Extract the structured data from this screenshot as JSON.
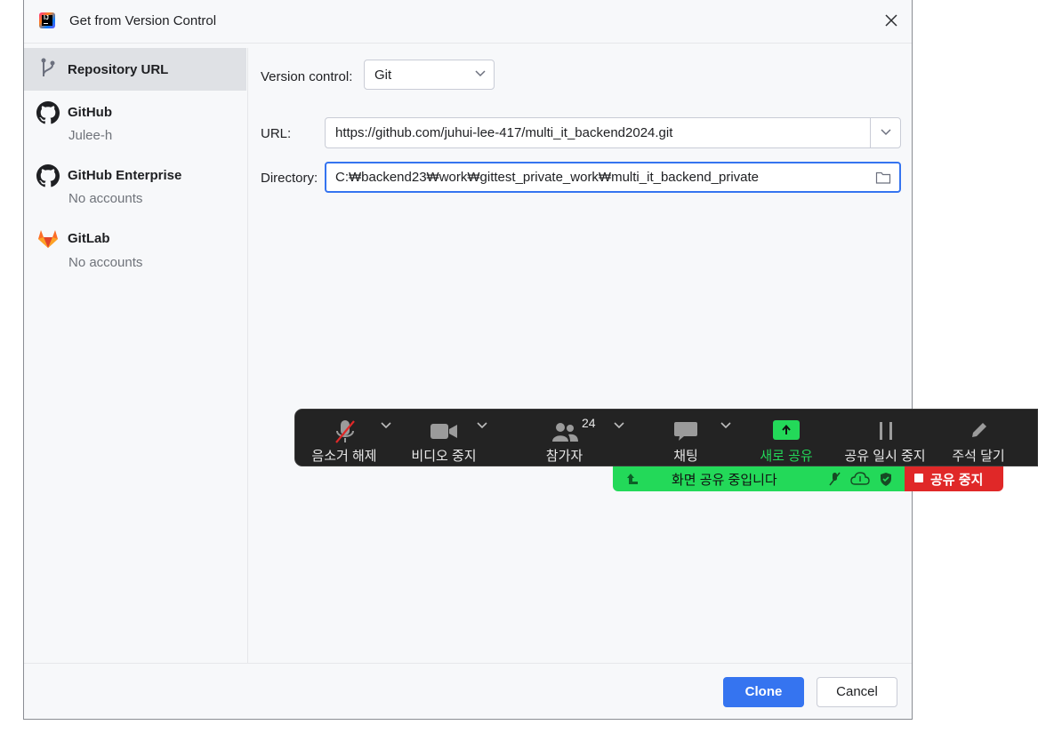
{
  "window": {
    "title": "Get from Version Control"
  },
  "sidebar": {
    "items": [
      {
        "title": "Repository URL",
        "subtitle": ""
      },
      {
        "title": "GitHub",
        "subtitle": "Julee-h"
      },
      {
        "title": "GitHub Enterprise",
        "subtitle": "No accounts"
      },
      {
        "title": "GitLab",
        "subtitle": "No accounts"
      }
    ]
  },
  "form": {
    "vcs_label": "Version control:",
    "vcs_value": "Git",
    "url_label": "URL:",
    "url_value": "https://github.com/juhui-lee-417/multi_it_backend2024.git",
    "dir_label": "Directory:",
    "dir_value": "C:₩backend23₩work₩gittest_private_work₩multi_it_backend_private"
  },
  "footer": {
    "clone_label": "Clone",
    "cancel_label": "Cancel"
  },
  "zoom": {
    "mute_label": "음소거 해제",
    "video_label": "비디오 중지",
    "participants_label": "참가자",
    "participants_count": "24",
    "chat_label": "채팅",
    "new_share_label": "새로 공유",
    "pause_share_label": "공유 일시 중지",
    "annotate_label": "주석 달기",
    "sharing_status": "화면 공유 중입니다",
    "stop_share_label": "공유 중지",
    "accent_green": "#23d959",
    "stop_red": "#e02828"
  }
}
